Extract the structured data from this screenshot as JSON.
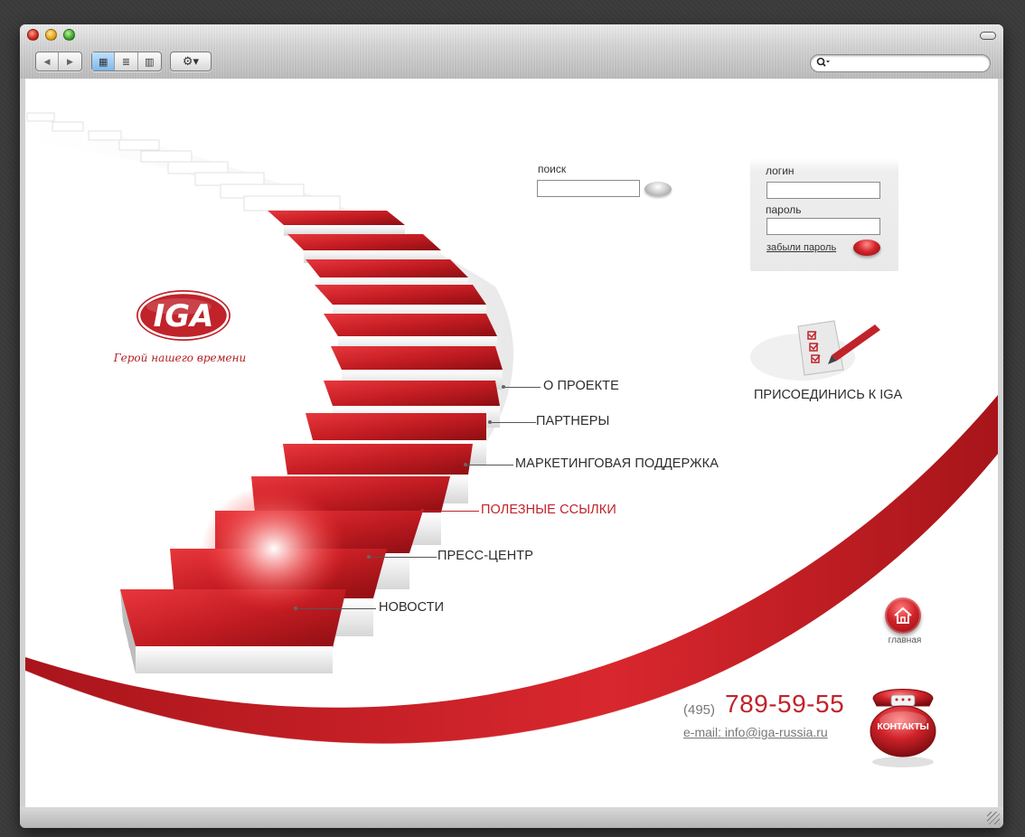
{
  "toolbar": {
    "back_label": "◀",
    "forward_label": "▶",
    "view_icon_label": "▦",
    "view_list_label": "≣",
    "view_column_label": "▥",
    "gear_label": "⚙▾",
    "search_icon_label": "🔍▾",
    "search_value": ""
  },
  "brand": {
    "logo_text": "IGA",
    "slogan": "Герой нашего времени",
    "accent_color": "#c0232a"
  },
  "menu": {
    "items": [
      {
        "label": "О ПРОЕКТЕ",
        "active": false
      },
      {
        "label": "ПАРТНЕРЫ",
        "active": false
      },
      {
        "label": "МАРКЕТИНГОВАЯ ПОДДЕРЖКА",
        "active": false
      },
      {
        "label": "ПОЛЕЗНЫЕ ССЫЛКИ",
        "active": true
      },
      {
        "label": "ПРЕСС-ЦЕНТР",
        "active": false
      },
      {
        "label": "НОВОСТИ",
        "active": false
      }
    ]
  },
  "search": {
    "label": "поиск",
    "value": ""
  },
  "login": {
    "login_label": "логин",
    "login_value": "",
    "password_label": "пароль",
    "password_value": "",
    "forgot_label": "забыли пароль"
  },
  "join": {
    "label": "ПРИСОЕДИНИСЬ К IGA"
  },
  "home": {
    "label": "главная"
  },
  "contacts": {
    "phone_code": "(495)",
    "phone_number": "789-59-55",
    "email": "e-mail: info@iga-russia.ru",
    "button_label": "КОНТАКТЫ"
  }
}
